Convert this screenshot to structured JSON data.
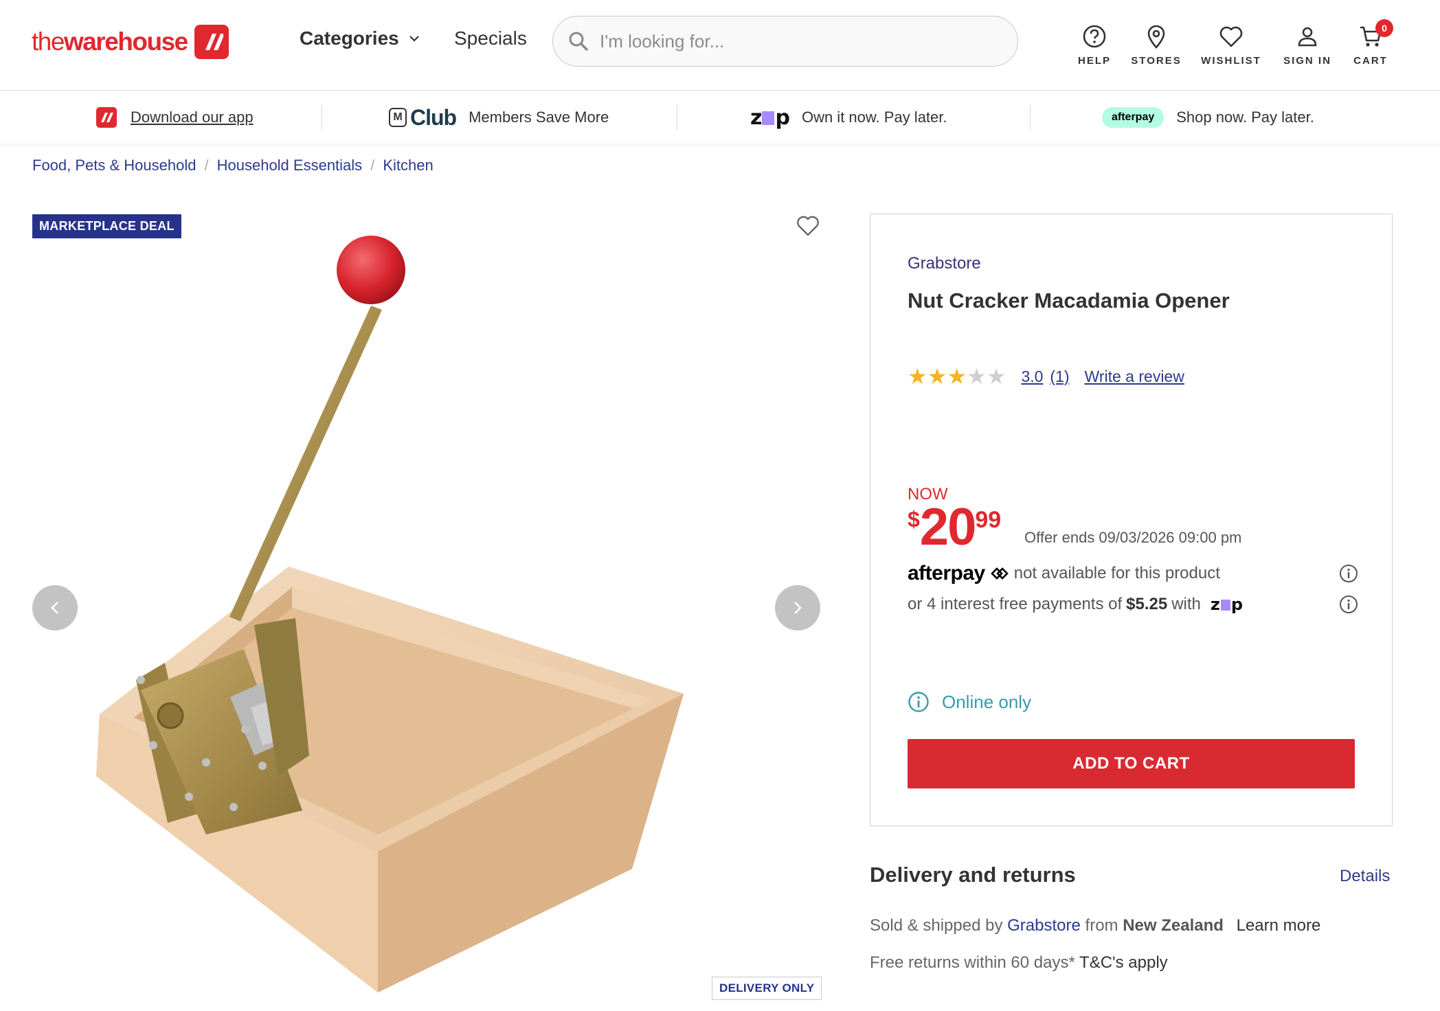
{
  "header": {
    "logo_light": "the",
    "logo_bold": "warehouse",
    "categories_label": "Categories",
    "specials_label": "Specials",
    "search_placeholder": "I'm looking for...",
    "utilities": {
      "help": "HELP",
      "stores": "STORES",
      "wishlist": "WISHLIST",
      "sign_in": "SIGN IN",
      "cart": "CART",
      "cart_count": "0"
    }
  },
  "promo_bar": {
    "download_app": "Download our app",
    "club_logo": "Club",
    "club_m": "M",
    "club_text": "Members Save More",
    "zip_text": "Own it now. Pay later.",
    "afterpay_pill": "afterpay",
    "afterpay_text": "Shop now. Pay later."
  },
  "breadcrumb": [
    "Food, Pets & Household",
    "Household Essentials",
    "Kitchen"
  ],
  "gallery": {
    "deal_badge": "MARKETPLACE DEAL",
    "delivery_only": "DELIVERY ONLY"
  },
  "product": {
    "brand": "Grabstore",
    "title": "Nut Cracker Macadamia Opener",
    "rating_value": "3.0",
    "rating_fraction": 0.6,
    "review_count": "(1)",
    "write_review": "Write a review",
    "now_label": "NOW",
    "price_currency": "$",
    "price_dollars": "20",
    "price_cents": "99",
    "offer_text": "Offer ends  09/03/2026 09:00 pm",
    "afterpay_word": "afterpay",
    "afterpay_note": "not available for this product",
    "zip_prefix": "or 4 interest free payments of",
    "zip_amount": "$5.25",
    "zip_suffix": "with",
    "online_only": "Online only",
    "add_to_cart": "ADD TO CART"
  },
  "delivery": {
    "title": "Delivery and returns",
    "details_link": "Details",
    "sold_prefix": "Sold & shipped by",
    "seller": "Grabstore",
    "from_label": "from",
    "origin": "New Zealand",
    "learn_more": "Learn more",
    "returns_text": "Free returns within 60 days*",
    "tc_link": "T&C's apply"
  },
  "colors": {
    "brand_red": "#e0282e",
    "link_blue": "#2c3a8c",
    "deal_navy": "#27328a",
    "star_gold": "#f5b324",
    "online_teal": "#3a9aa8"
  }
}
